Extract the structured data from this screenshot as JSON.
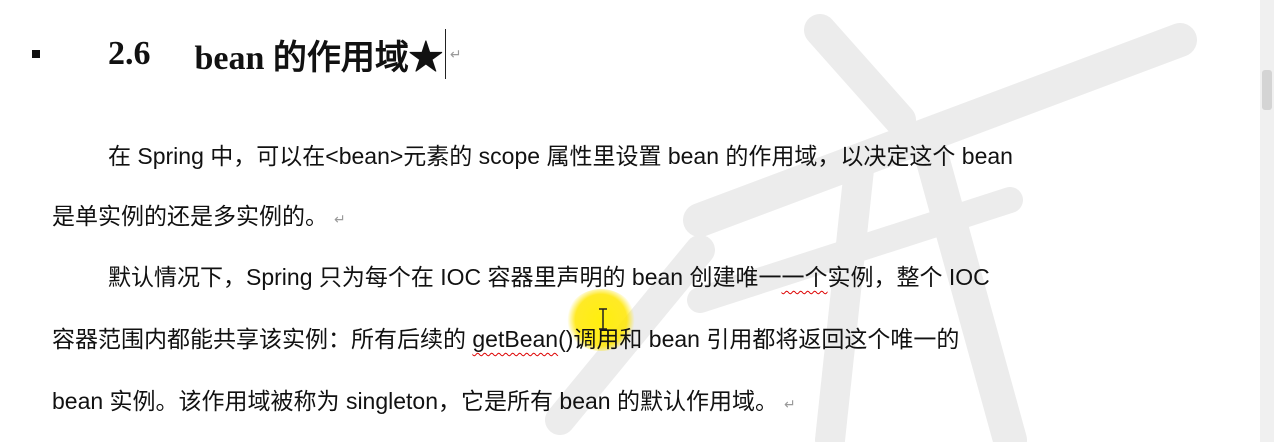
{
  "heading": {
    "number": "2.6",
    "title": "bean 的作用域★"
  },
  "paragraph_marks": {
    "mark": "↵"
  },
  "paragraph1": {
    "line1": "在 Spring 中，可以在<bean>元素的 scope 属性里设置 bean 的作用域，以决定这个 bean",
    "line2": "是单实例的还是多实例的。"
  },
  "paragraph2": {
    "line1_a": "默认情况下，Spring 只为每个在 IOC 容器里声明的 bean 创建唯一",
    "line1_b": "一个",
    "line1_c": "实例，整个 IOC",
    "line2_a": "容器范围内都能共享该实例：所有后续的 ",
    "line2_b": "getBean",
    "line2_c": "()调用和 bean 引用都将返回这个唯一的",
    "line3": "bean 实例。该作用域被称为 singleton，它是所有 bean 的默认作用域。"
  },
  "colors": {
    "text": "#111111",
    "highlight": "#FFE600",
    "spellcheck": "#DD0000",
    "watermark": "#E9E9E9"
  }
}
